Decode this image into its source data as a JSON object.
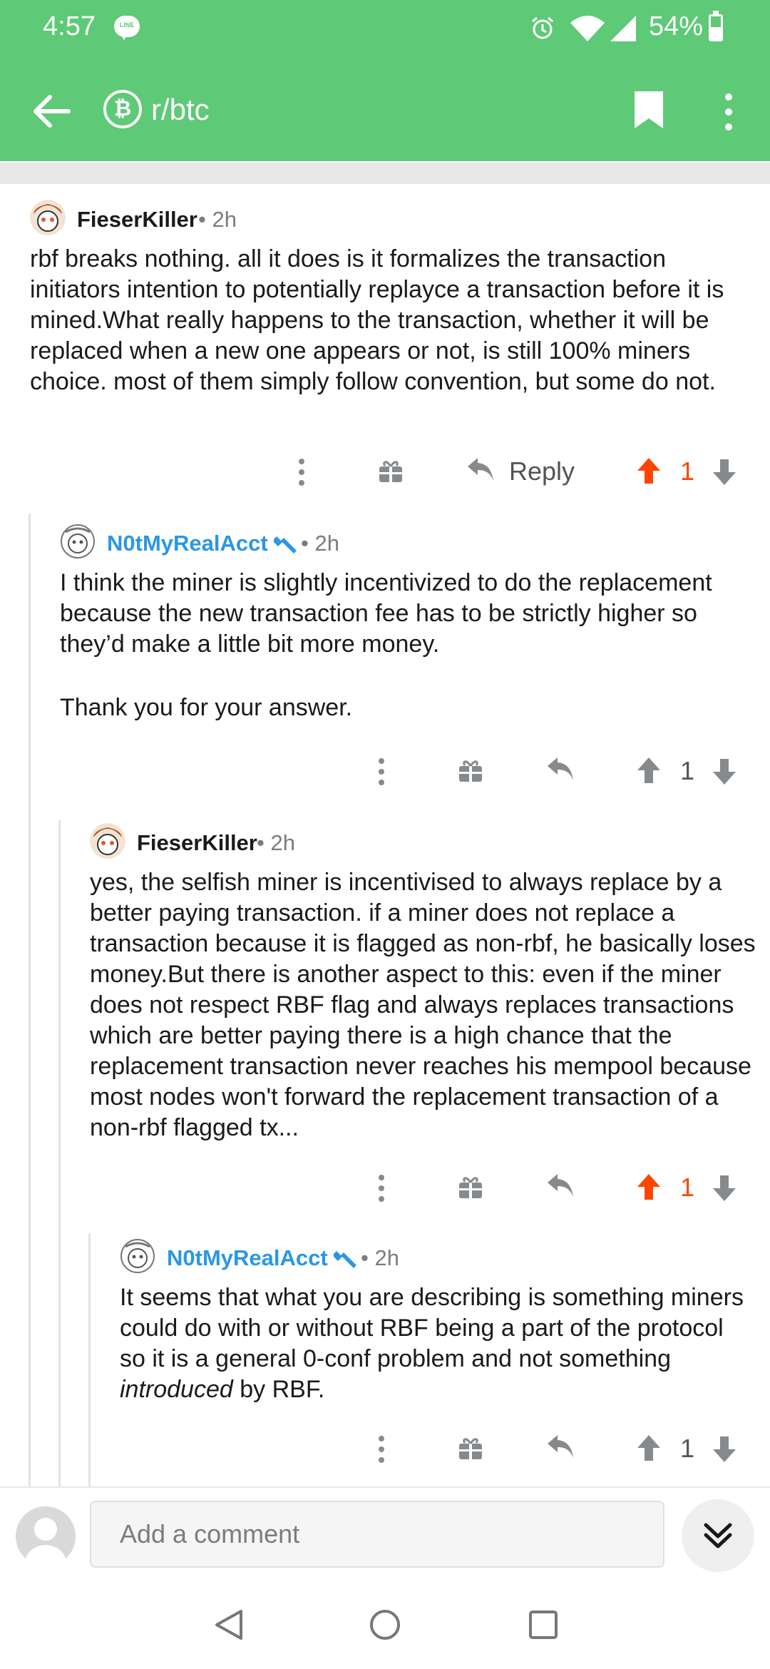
{
  "status_bar": {
    "time": "4:57",
    "line_badge": "LINE",
    "battery": "54%",
    "battery_level": 0.54
  },
  "app_bar": {
    "subreddit_icon": "₿",
    "subreddit": "r/btc"
  },
  "comments": [
    {
      "author": "FieserKiller",
      "mod_icon": false,
      "meta": "• 2h",
      "body": [
        "rbf breaks nothing. all it does is it formalizes the transaction initiators intention to potentially replayce a transaction before it is mined.What really happens to the transaction, whether it will be replaced when a new one appears or not, is still 100% miners choice. most of them simply follow convention, but some do not."
      ],
      "reply_label": "Reply",
      "score": "1",
      "upvoted": true
    },
    {
      "author": "N0tMyRealAcct",
      "mod_icon": true,
      "meta": "• 2h",
      "body": [
        "I think the miner is slightly incentivized to do the replacement because the new transaction fee has to be strictly higher so they’d make a little bit more money.",
        "Thank you for your answer."
      ],
      "score": "1",
      "upvoted": false
    },
    {
      "author": "FieserKiller",
      "mod_icon": false,
      "meta": "• 2h",
      "body": [
        "yes, the selfish miner is incentivised to always replace by a better paying transaction. if a miner does not replace a transaction because it is flagged as non-rbf, he basically loses money.But there is another aspect to this: even if the miner does not respect RBF flag and always replaces transactions which are better paying there is a high chance that the replacement transaction never reaches his mempool because most nodes won't forward the replacement transaction of a non-rbf flagged tx..."
      ],
      "score": "1",
      "upvoted": true
    },
    {
      "author": "N0tMyRealAcct",
      "mod_icon": true,
      "meta": "• 2h",
      "body_before": "It seems that what you are describing is something miners could do with or without RBF being a part of the protocol so it is a general 0-conf problem and not something ",
      "body_italic": "introduced",
      "body_after": " by RBF.",
      "score": "1",
      "upvoted": false
    }
  ],
  "composer": {
    "placeholder": "Add a comment"
  },
  "colors": {
    "app_bar": "#5ec977",
    "upvote": "#ff4500",
    "mod_username": "#2a97e4"
  }
}
